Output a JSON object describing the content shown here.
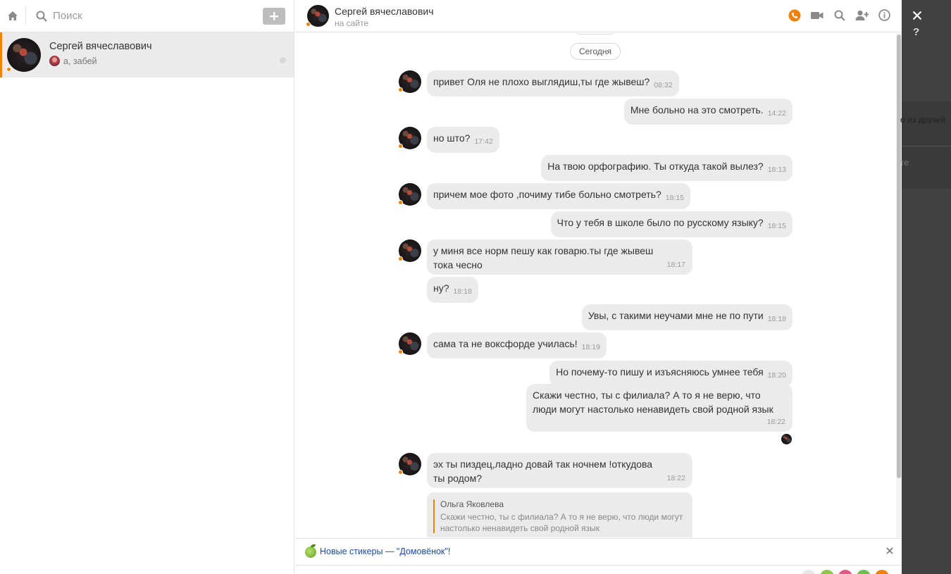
{
  "left_panel": {
    "search_placeholder": "Поиск",
    "conversation": {
      "name": "Сергей вячеславович",
      "last_message": "а, забей"
    }
  },
  "chat": {
    "title": "Сергей вячеславович",
    "status": "на сайте",
    "date_separator": "Сегодня",
    "messages": [
      {
        "text": "привет Оля не плохо выглядиш,ты где жывеш?",
        "time": "08:32"
      },
      {
        "text": "Мне больно на это смотреть.",
        "time": "14:22"
      },
      {
        "text": "но што?",
        "time": "17:42"
      },
      {
        "text": "На твою орфографию. Ты откуда такой вылез?",
        "time": "18:13"
      },
      {
        "text": "причем мое фото ,почиму тибе больно смотреть?",
        "time": "18:15"
      },
      {
        "text": "Что у тебя в школе было по русскому языку?",
        "time": "18:15"
      },
      {
        "text": "у миня все норм пешу как говарю.ты где жывеш тока чесно",
        "time": "18:17"
      },
      {
        "text": "ну?",
        "time": "18:18"
      },
      {
        "text": "Увы, с такими неучами мне не по пути",
        "time": "18:18"
      },
      {
        "text": "сама та не воксфорде училась!",
        "time": "18:19"
      },
      {
        "text": "Но почему-то пишу и изъясняюсь умнее тебя",
        "time": "18:20"
      },
      {
        "text": "Скажи честно, ты с филиала? А то я не верю, что люди могут настолько ненавидеть свой родной язык",
        "time": "18:22"
      },
      {
        "text": "эх ты пиздец,ладно довай так ночнем !откудова ты родом?",
        "time": "18:22"
      }
    ],
    "quote": {
      "author": "Ольга Яковлева",
      "text": "Скажи честно, ты с филиала? А то я не верю, что люди могут настолько ненавидеть свой родной язык"
    },
    "notice": "Новые стикеры — \"Домовёнок\"!"
  },
  "overlay": {
    "help": "?",
    "peek_text_1": "о из друзей",
    "peek_text_2": "те"
  },
  "colors": {
    "accent": "#ee8208",
    "bubble": "#ebebeb",
    "overlay": "#414141",
    "link": "#1b4ba0"
  },
  "icons": [
    "home-icon",
    "search-icon",
    "plus-icon",
    "phone-icon",
    "video-camera-icon",
    "search-icon",
    "add-user-icon",
    "info-icon",
    "close-icon",
    "apple-icon"
  ]
}
